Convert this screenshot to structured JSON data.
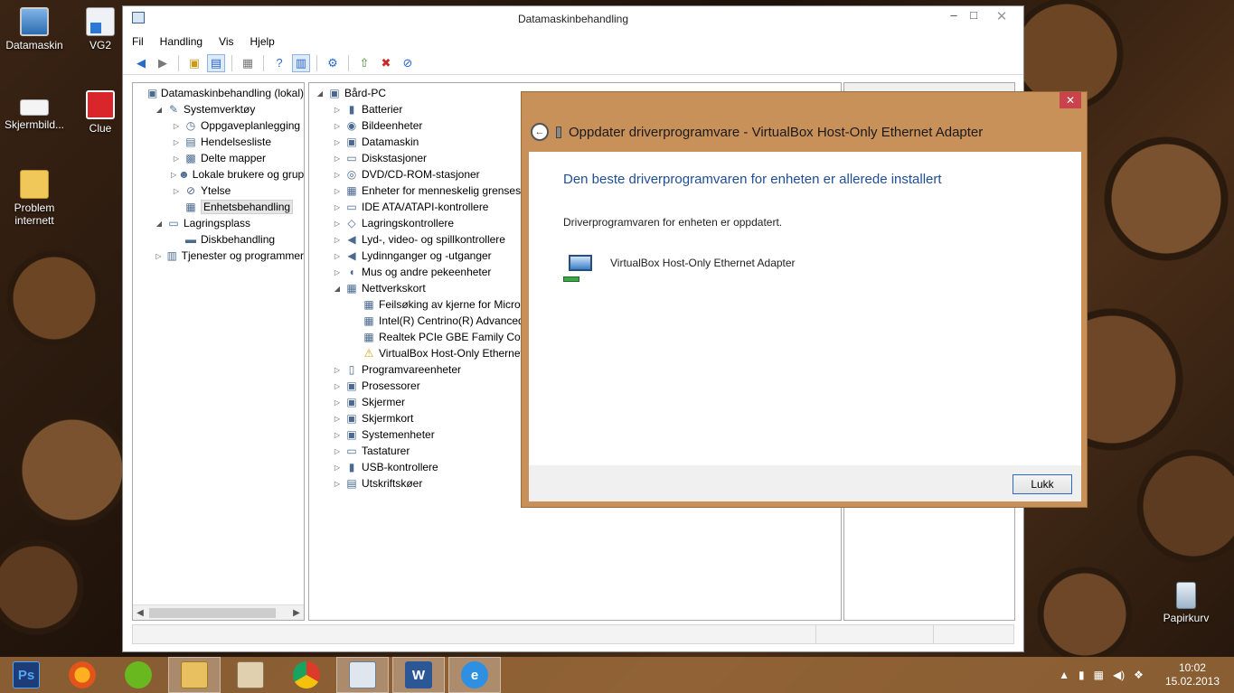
{
  "desktop": {
    "icons": [
      {
        "label": "Datamaskin"
      },
      {
        "label": "VG2"
      },
      {
        "label": "Skjermbild..."
      },
      {
        "label": "Clue"
      },
      {
        "label": "Problem internett"
      },
      {
        "label": "Papirkurv"
      }
    ]
  },
  "mmc": {
    "title": "Datamaskinbehandling",
    "controls": {
      "minimize": "–",
      "maximize": "□",
      "close": "✕"
    },
    "menu": [
      "Fil",
      "Handling",
      "Vis",
      "Hjelp"
    ],
    "toolbar_icons": [
      "back-icon",
      "forward-icon",
      "up-folder-icon",
      "show-hide-tree-icon",
      "properties-icon",
      "help-icon",
      "show-hide-action-icon",
      "scan-icon",
      "update-driver-icon",
      "uninstall-icon",
      "disable-icon"
    ],
    "left_tree": [
      {
        "label": "Datamaskinbehandling (lokal)",
        "depth": 0,
        "arrow": "",
        "icon": "computer-mgmt-icon"
      },
      {
        "label": "Systemverktøy",
        "depth": 1,
        "arrow": "◢",
        "icon": "tools-icon"
      },
      {
        "label": "Oppgaveplanlegging",
        "depth": 2,
        "arrow": "▷",
        "icon": "clock-icon"
      },
      {
        "label": "Hendelsesliste",
        "depth": 2,
        "arrow": "▷",
        "icon": "event-log-icon"
      },
      {
        "label": "Delte mapper",
        "depth": 2,
        "arrow": "▷",
        "icon": "shared-folder-icon"
      },
      {
        "label": "Lokale brukere og grupper",
        "depth": 2,
        "arrow": "▷",
        "icon": "users-icon"
      },
      {
        "label": "Ytelse",
        "depth": 2,
        "arrow": "▷",
        "icon": "performance-icon"
      },
      {
        "label": "Enhetsbehandling",
        "depth": 2,
        "arrow": "",
        "icon": "device-manager-icon",
        "selected": true
      },
      {
        "label": "Lagringsplass",
        "depth": 1,
        "arrow": "◢",
        "icon": "storage-icon"
      },
      {
        "label": "Diskbehandling",
        "depth": 2,
        "arrow": "",
        "icon": "disk-mgmt-icon"
      },
      {
        "label": "Tjenester og programmer",
        "depth": 1,
        "arrow": "▷",
        "icon": "services-icon"
      }
    ],
    "device_tree": [
      {
        "label": "Bård-PC",
        "depth": 0,
        "arrow": "◢",
        "icon": "computer-icon"
      },
      {
        "label": "Batterier",
        "depth": 1,
        "arrow": "▷",
        "icon": "battery-icon"
      },
      {
        "label": "Bildeenheter",
        "depth": 1,
        "arrow": "▷",
        "icon": "camera-icon"
      },
      {
        "label": "Datamaskin",
        "depth": 1,
        "arrow": "▷",
        "icon": "monitor-icon"
      },
      {
        "label": "Diskstasjoner",
        "depth": 1,
        "arrow": "▷",
        "icon": "disk-icon"
      },
      {
        "label": "DVD/CD-ROM-stasjoner",
        "depth": 1,
        "arrow": "▷",
        "icon": "dvd-icon"
      },
      {
        "label": "Enheter for menneskelig grensesnitt",
        "depth": 1,
        "arrow": "▷",
        "icon": "hid-icon"
      },
      {
        "label": "IDE ATA/ATAPI-kontrollere",
        "depth": 1,
        "arrow": "▷",
        "icon": "ide-icon"
      },
      {
        "label": "Lagringskontrollere",
        "depth": 1,
        "arrow": "▷",
        "icon": "storage-controller-icon"
      },
      {
        "label": "Lyd-, video- og spillkontrollere",
        "depth": 1,
        "arrow": "▷",
        "icon": "speaker-icon"
      },
      {
        "label": "Lydinnganger og -utganger",
        "depth": 1,
        "arrow": "▷",
        "icon": "audio-io-icon"
      },
      {
        "label": "Mus og andre pekeenheter",
        "depth": 1,
        "arrow": "▷",
        "icon": "mouse-icon"
      },
      {
        "label": "Nettverkskort",
        "depth": 1,
        "arrow": "◢",
        "icon": "network-icon"
      },
      {
        "label": "Feilsøking av kjerne for Microsoft",
        "depth": 2,
        "arrow": "",
        "icon": "network-adapter-icon"
      },
      {
        "label": "Intel(R) Centrino(R) Advanced",
        "depth": 2,
        "arrow": "",
        "icon": "network-adapter-icon"
      },
      {
        "label": "Realtek PCIe GBE Family Controller",
        "depth": 2,
        "arrow": "",
        "icon": "network-adapter-icon"
      },
      {
        "label": "VirtualBox Host-Only Ethernet",
        "depth": 2,
        "arrow": "",
        "icon": "network-adapter-warning-icon"
      },
      {
        "label": "Programvareenheter",
        "depth": 1,
        "arrow": "▷",
        "icon": "software-device-icon"
      },
      {
        "label": "Prosessorer",
        "depth": 1,
        "arrow": "▷",
        "icon": "cpu-icon"
      },
      {
        "label": "Skjermer",
        "depth": 1,
        "arrow": "▷",
        "icon": "display-icon"
      },
      {
        "label": "Skjermkort",
        "depth": 1,
        "arrow": "▷",
        "icon": "display-adapter-icon"
      },
      {
        "label": "Systemenheter",
        "depth": 1,
        "arrow": "▷",
        "icon": "system-device-icon"
      },
      {
        "label": "Tastaturer",
        "depth": 1,
        "arrow": "▷",
        "icon": "keyboard-icon"
      },
      {
        "label": "USB-kontrollere",
        "depth": 1,
        "arrow": "▷",
        "icon": "usb-icon"
      },
      {
        "label": "Utskriftskøer",
        "depth": 1,
        "arrow": "▷",
        "icon": "printer-icon"
      }
    ]
  },
  "dialog": {
    "title": "Oppdater driverprogramvare - VirtualBox Host-Only Ethernet Adapter",
    "close": "✕",
    "back": "←",
    "heading": "Den beste driverprogramvaren for enheten er allerede installert",
    "message": "Driverprogramvaren for enheten er oppdatert.",
    "device_name": "VirtualBox Host-Only Ethernet Adapter",
    "close_button": "Lukk",
    "accent": "#c9915a"
  },
  "taskbar": {
    "apps": [
      {
        "name": "photoshop-icon",
        "glyph": "Ps"
      },
      {
        "name": "firefox-icon",
        "glyph": ""
      },
      {
        "name": "spotify-icon",
        "glyph": ""
      },
      {
        "name": "file-explorer-icon",
        "glyph": ""
      },
      {
        "name": "photo-viewer-icon",
        "glyph": ""
      },
      {
        "name": "chrome-icon",
        "glyph": ""
      },
      {
        "name": "computer-management-icon",
        "glyph": ""
      },
      {
        "name": "word-icon",
        "glyph": "W"
      },
      {
        "name": "internet-explorer-icon",
        "glyph": "e"
      }
    ],
    "time": "10:02",
    "date": "15.02.2013"
  }
}
